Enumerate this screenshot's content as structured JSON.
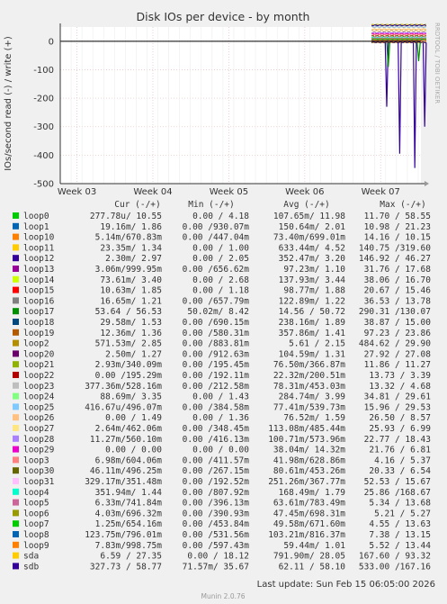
{
  "chart_data": {
    "type": "line",
    "title": "Disk IOs per device - by month",
    "ylabel": "IOs/second read (-) / write (+)",
    "side_label": "RRDTOOL / TOBI OETIKER",
    "ylim": [
      -500,
      50
    ],
    "yticks": [
      0,
      -100,
      -200,
      -300,
      -400,
      -500
    ],
    "x_ticks": [
      "Week 03",
      "Week 04",
      "Week 05",
      "Week 06",
      "Week 07"
    ],
    "grid": true,
    "legend_headers": {
      "cur": "Cur (-/+)",
      "min": "Min (-/+)",
      "avg": "Avg (-/+)",
      "max": "Max (-/+)"
    },
    "series": [
      {
        "name": "loop0",
        "color": "#00cc00",
        "cur": "277.78u/ 10.55",
        "min": "0.00 /  4.18",
        "avg": "107.65m/ 11.98",
        "max": "11.70 / 58.55"
      },
      {
        "name": "loop1",
        "color": "#0066b3",
        "cur": "19.16m/  1.86",
        "min": "0.00 /930.07m",
        "avg": "150.64m/  2.01",
        "max": "10.98 / 21.23"
      },
      {
        "name": "loop10",
        "color": "#ff8000",
        "cur": "5.14m/670.83m",
        "min": "0.00 /447.04m",
        "avg": "73.40m/699.01m",
        "max": "14.16 / 10.15"
      },
      {
        "name": "loop11",
        "color": "#ffcc00",
        "cur": "23.35m/  1.34",
        "min": "0.00 /  1.00",
        "avg": "633.44m/  4.52",
        "max": "140.75 /319.60"
      },
      {
        "name": "loop12",
        "color": "#330099",
        "cur": "2.30m/  2.97",
        "min": "0.00 /  2.05",
        "avg": "352.47m/  3.20",
        "max": "146.92 / 46.27"
      },
      {
        "name": "loop13",
        "color": "#990099",
        "cur": "3.06m/999.95m",
        "min": "0.00 /656.62m",
        "avg": "97.23m/  1.10",
        "max": "31.76 / 17.68"
      },
      {
        "name": "loop14",
        "color": "#ccff00",
        "cur": "73.61m/  3.40",
        "min": "0.00 /  2.68",
        "avg": "137.93m/  3.44",
        "max": "38.06 / 16.70"
      },
      {
        "name": "loop15",
        "color": "#ff0000",
        "cur": "10.63m/  1.85",
        "min": "0.00 /  1.18",
        "avg": "98.77m/  1.88",
        "max": "20.67 / 15.46"
      },
      {
        "name": "loop16",
        "color": "#808080",
        "cur": "16.65m/  1.21",
        "min": "0.00 /657.79m",
        "avg": "122.89m/  1.22",
        "max": "36.53 / 13.78"
      },
      {
        "name": "loop17",
        "color": "#008f00",
        "cur": "53.64 / 56.53",
        "min": "50.02m/  8.42",
        "avg": "14.56 / 50.72",
        "max": "290.31 /130.07"
      },
      {
        "name": "loop18",
        "color": "#00487d",
        "cur": "29.58m/  1.53",
        "min": "0.00 /690.15m",
        "avg": "238.16m/  1.89",
        "max": "38.87 / 15.00"
      },
      {
        "name": "loop19",
        "color": "#b35a00",
        "cur": "12.36m/  1.36",
        "min": "0.00 /580.31m",
        "avg": "357.86m/  1.41",
        "max": "97.23 / 23.86"
      },
      {
        "name": "loop2",
        "color": "#b38f00",
        "cur": "571.53m/  2.85",
        "min": "0.00 /883.81m",
        "avg": "5.61 /  2.15",
        "max": "484.62 / 29.90"
      },
      {
        "name": "loop20",
        "color": "#6b006b",
        "cur": "2.50m/  1.27",
        "min": "0.00 /912.63m",
        "avg": "104.59m/  1.31",
        "max": "27.92 / 27.08"
      },
      {
        "name": "loop21",
        "color": "#8fb300",
        "cur": "2.93m/340.09m",
        "min": "0.00 /195.45m",
        "avg": "76.50m/366.87m",
        "max": "11.86 / 11.27"
      },
      {
        "name": "loop22",
        "color": "#b30000",
        "cur": "0.00 /195.29m",
        "min": "0.00 /192.11m",
        "avg": "22.32m/200.51m",
        "max": "13.73 /  3.39"
      },
      {
        "name": "loop23",
        "color": "#bebebe",
        "cur": "377.36m/528.16m",
        "min": "0.00 /212.58m",
        "avg": "78.31m/453.03m",
        "max": "13.32 /  4.68"
      },
      {
        "name": "loop24",
        "color": "#80ff80",
        "cur": "88.69m/  3.35",
        "min": "0.00 /  1.43",
        "avg": "284.74m/  3.99",
        "max": "34.81 / 29.61"
      },
      {
        "name": "loop25",
        "color": "#80c9ff",
        "cur": "416.67u/496.07m",
        "min": "0.00 /384.58m",
        "avg": "77.41m/539.73m",
        "max": "15.96 / 29.53"
      },
      {
        "name": "loop26",
        "color": "#ffc080",
        "cur": "0.00 /  1.49",
        "min": "0.00 /  1.36",
        "avg": "76.52m/  1.59",
        "max": "26.50 /  8.57"
      },
      {
        "name": "loop27",
        "color": "#ffe680",
        "cur": "2.64m/462.06m",
        "min": "0.00 /348.45m",
        "avg": "113.08m/485.44m",
        "max": "25.93 /  6.99"
      },
      {
        "name": "loop28",
        "color": "#aa80ff",
        "cur": "11.27m/560.10m",
        "min": "0.00 /416.13m",
        "avg": "100.71m/573.96m",
        "max": "22.77 / 18.43"
      },
      {
        "name": "loop29",
        "color": "#ee00cc",
        "cur": "0.00 /  0.00",
        "min": "0.00 /  0.00",
        "avg": "38.04m/ 14.32m",
        "max": "21.76 /  6.81"
      },
      {
        "name": "loop3",
        "color": "#ff8080",
        "cur": "6.98m/604.06m",
        "min": "0.00 /411.57m",
        "avg": "41.98m/628.86m",
        "max": "4.16 /  5.37"
      },
      {
        "name": "loop30",
        "color": "#666600",
        "cur": "46.11m/496.25m",
        "min": "0.00 /267.15m",
        "avg": "80.61m/453.26m",
        "max": "20.33 /  6.54"
      },
      {
        "name": "loop31",
        "color": "#ffbfff",
        "cur": "329.17m/351.48m",
        "min": "0.00 /192.52m",
        "avg": "251.26m/367.77m",
        "max": "52.53 / 15.67"
      },
      {
        "name": "loop4",
        "color": "#00ffcc",
        "cur": "351.94m/  1.44",
        "min": "0.00 /807.92m",
        "avg": "168.49m/  1.79",
        "max": "25.86 /168.67"
      },
      {
        "name": "loop5",
        "color": "#cc6699",
        "cur": "6.33m/741.84m",
        "min": "0.00 /396.13m",
        "avg": "63.61m/783.49m",
        "max": "5.34 / 13.68"
      },
      {
        "name": "loop6",
        "color": "#999900",
        "cur": "4.03m/696.32m",
        "min": "0.00 /390.93m",
        "avg": "47.45m/698.31m",
        "max": "5.21 /  5.27"
      },
      {
        "name": "loop7",
        "color": "#00cc00",
        "cur": "1.25m/654.16m",
        "min": "0.00 /453.84m",
        "avg": "49.58m/671.60m",
        "max": "4.55 / 13.63"
      },
      {
        "name": "loop8",
        "color": "#0066b3",
        "cur": "123.75m/796.01m",
        "min": "0.00 /531.56m",
        "avg": "103.21m/816.37m",
        "max": "7.38 / 13.15"
      },
      {
        "name": "loop9",
        "color": "#ff8000",
        "cur": "7.83m/998.75m",
        "min": "0.00 /597.43m",
        "avg": "59.44m/  1.01",
        "max": "5.52 / 13.44"
      },
      {
        "name": "sda",
        "color": "#ffcc00",
        "cur": "6.59 / 27.35",
        "min": "0.00 / 18.12",
        "avg": "791.90m/ 28.05",
        "max": "167.60 / 93.32"
      },
      {
        "name": "sdb",
        "color": "#330099",
        "cur": "327.73 / 58.77",
        "min": "71.57m/ 35.67",
        "avg": "62.11 / 58.10",
        "max": "533.00 /167.16"
      }
    ],
    "read_spikes": [
      {
        "series": "sdb",
        "week": 7.08,
        "value": -230
      },
      {
        "series": "sdb",
        "week": 7.25,
        "value": -395
      },
      {
        "series": "sdb",
        "week": 7.45,
        "value": -445
      },
      {
        "series": "sdb",
        "week": 7.58,
        "value": -300
      },
      {
        "series": "loop17",
        "week": 7.1,
        "value": -90
      },
      {
        "series": "loop17",
        "week": 7.5,
        "value": -70
      }
    ]
  },
  "footer": {
    "last_update": "Last update: Sun Feb 15 06:05:00 2026",
    "version": "Munin 2.0.76"
  }
}
